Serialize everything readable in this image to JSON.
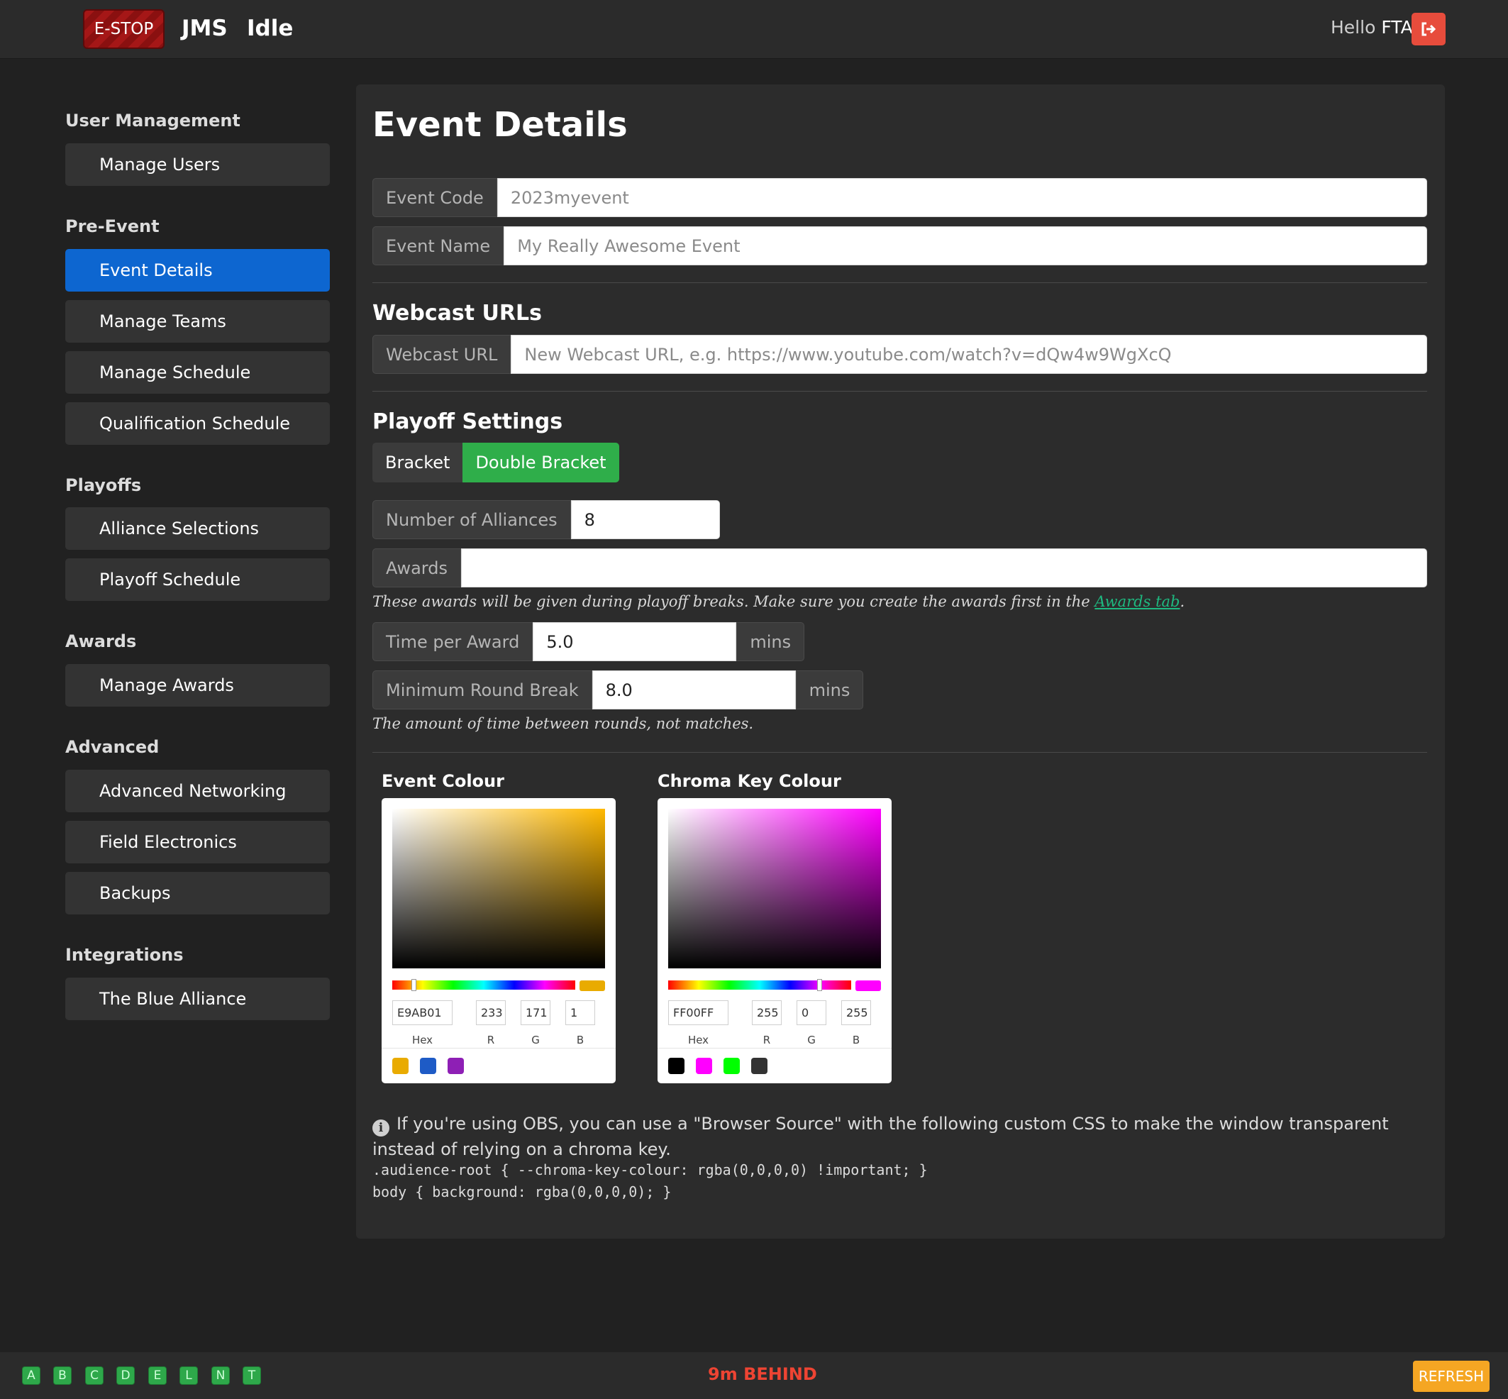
{
  "navbar": {
    "estop_label": "E-STOP",
    "brand": "JMS",
    "status": "Idle",
    "greeting": "Hello",
    "user": "FTA",
    "logout_icon": "sign-out-icon"
  },
  "sidebar": {
    "sections": [
      {
        "title": "User Management",
        "items": [
          "Manage Users"
        ]
      },
      {
        "title": "Pre-Event",
        "items": [
          "Event Details",
          "Manage Teams",
          "Manage Schedule",
          "Qualification Schedule"
        ]
      },
      {
        "title": "Playoffs",
        "items": [
          "Alliance Selections",
          "Playoff Schedule"
        ]
      },
      {
        "title": "Awards",
        "items": [
          "Manage Awards"
        ]
      },
      {
        "title": "Advanced",
        "items": [
          "Advanced Networking",
          "Field Electronics",
          "Backups"
        ]
      },
      {
        "title": "Integrations",
        "items": [
          "The Blue Alliance"
        ]
      }
    ],
    "active_item": "Event Details"
  },
  "main": {
    "title": "Event Details",
    "event_code": {
      "label": "Event Code",
      "placeholder": "2023myevent",
      "value": ""
    },
    "event_name": {
      "label": "Event Name",
      "placeholder": "My Really Awesome Event",
      "value": ""
    },
    "webcast": {
      "heading": "Webcast URLs",
      "label": "Webcast URL",
      "placeholder": "New Webcast URL, e.g. https://www.youtube.com/watch?v=dQw4w9WgXcQ"
    },
    "playoff": {
      "heading": "Playoff Settings",
      "modes": [
        "Bracket",
        "Double Bracket"
      ],
      "selected_mode": "Double Bracket",
      "alliances_label": "Number of Alliances",
      "alliances_value": "8",
      "awards_label": "Awards",
      "awards_value": "",
      "awards_help": "These awards will be given during playoff breaks. Make sure you create the awards first in the",
      "awards_link": "Awards tab",
      "awards_help_end": ".",
      "time_per_award_label": "Time per Award",
      "time_per_award_value": "5.0",
      "min_round_break_label": "Minimum Round Break",
      "min_round_break_value": "8.0",
      "unit": "mins",
      "round_help": "The amount of time between rounds, not matches."
    },
    "event_colour": {
      "title": "Event Colour",
      "hex": "E9AB01",
      "r": "233",
      "g": "171",
      "b": "1",
      "hue_color": "#ffb800",
      "current": "#e9ab01",
      "swatches": [
        "#e9ab01",
        "#1e5bc6",
        "#8e1fb5"
      ]
    },
    "chroma_colour": {
      "title": "Chroma Key Colour",
      "hex": "FF00FF",
      "r": "255",
      "g": "0",
      "b": "255",
      "hue_color": "#ff00ff",
      "current": "#ff00ff",
      "swatches": [
        "#000000",
        "#ff00ff",
        "#00ff00",
        "#333333"
      ]
    },
    "picker_labels": {
      "hex": "Hex",
      "r": "R",
      "g": "G",
      "b": "B"
    },
    "obs_info": "If you're using OBS, you can use a \"Browser Source\" with the following custom CSS to make the window transparent instead of relying on a chroma key.",
    "obs_code": [
      ".audience-root { --chroma-key-colour: rgba(0,0,0,0) !important; }",
      "body { background: rgba(0,0,0,0); }"
    ]
  },
  "footer": {
    "indicators": [
      "A",
      "B",
      "C",
      "D",
      "E",
      "L",
      "N",
      "T"
    ],
    "schedule_status": "9m BEHIND",
    "refresh_label": "REFRESH"
  }
}
